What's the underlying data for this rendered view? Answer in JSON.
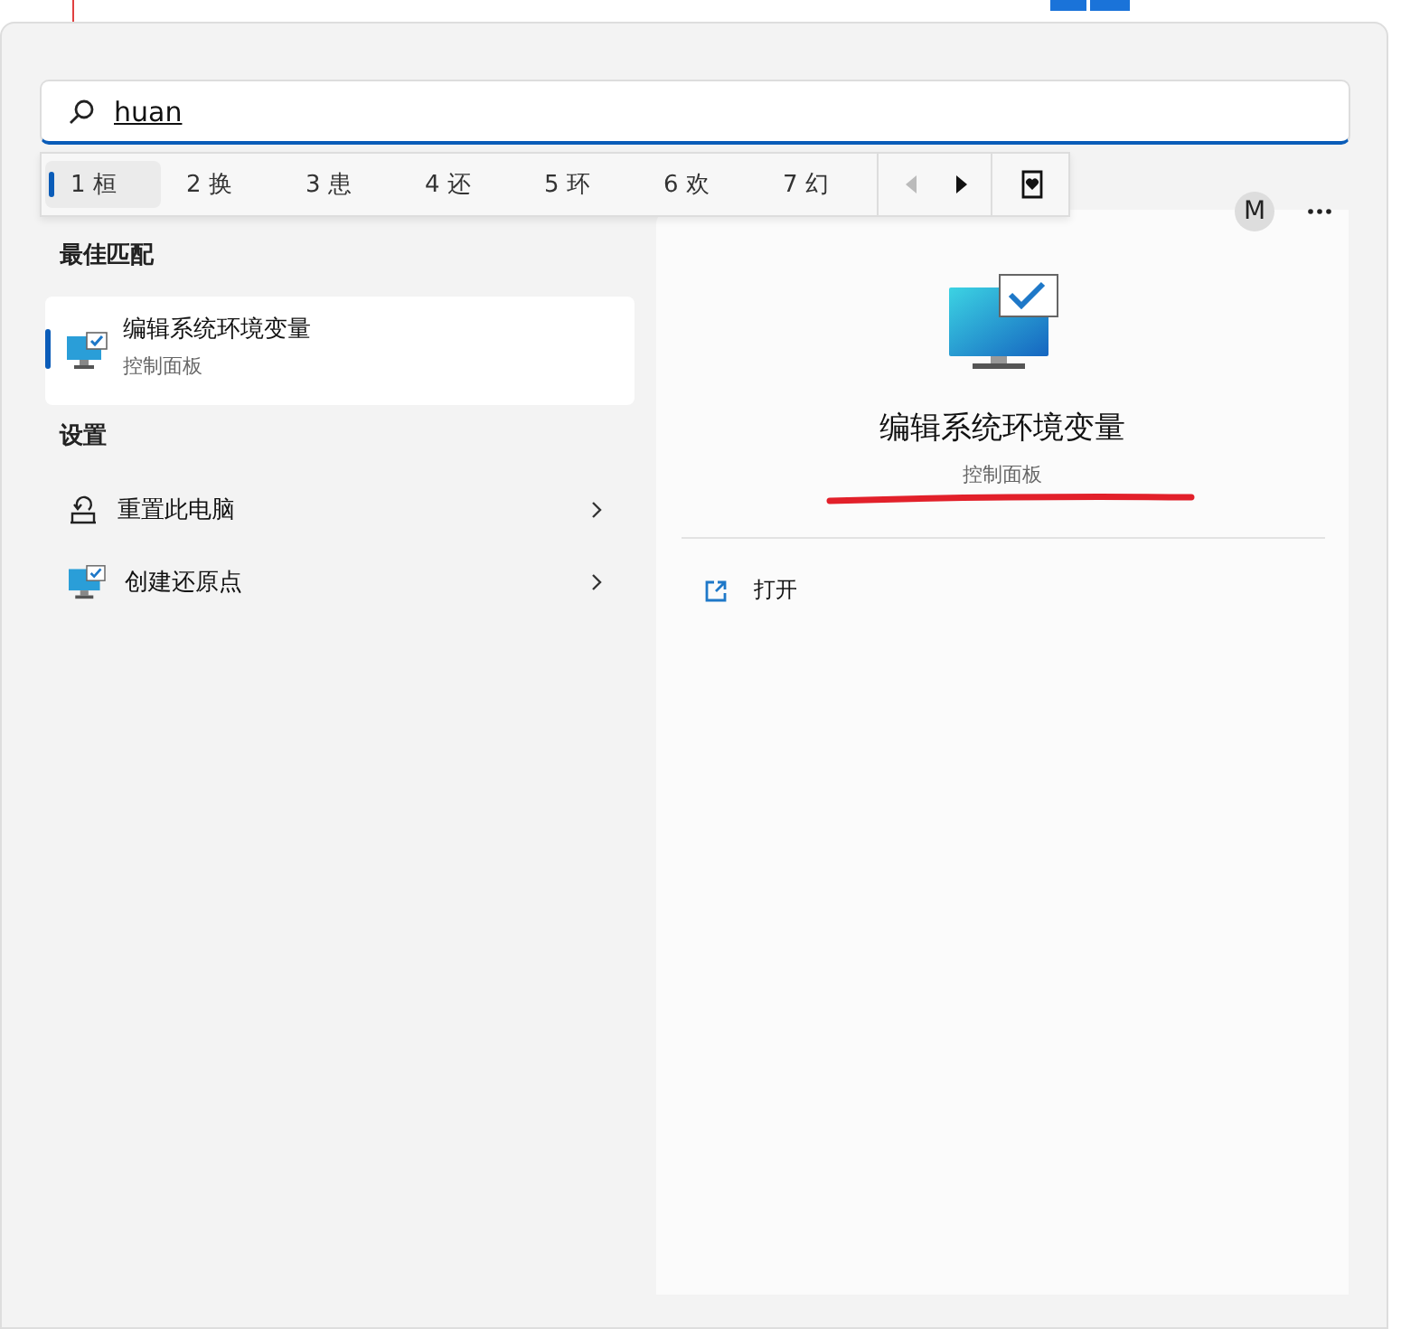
{
  "search": {
    "value": "huan"
  },
  "ime_candidates": [
    {
      "number": "1",
      "text": "桓",
      "selected": true
    },
    {
      "number": "2",
      "text": "换",
      "selected": false
    },
    {
      "number": "3",
      "text": "患",
      "selected": false
    },
    {
      "number": "4",
      "text": "还",
      "selected": false
    },
    {
      "number": "5",
      "text": "环",
      "selected": false
    },
    {
      "number": "6",
      "text": "欢",
      "selected": false
    },
    {
      "number": "7",
      "text": "幻",
      "selected": false
    }
  ],
  "account": {
    "initial": "M"
  },
  "best_match": {
    "heading": "最佳匹配",
    "item": {
      "title": "编辑系统环境变量",
      "subtitle": "控制面板",
      "selected": true
    }
  },
  "settings": {
    "heading": "设置",
    "items": [
      {
        "kind": "reset",
        "title": "重置此电脑"
      },
      {
        "kind": "monitor",
        "title": "创建还原点"
      }
    ]
  },
  "detail": {
    "title": "编辑系统环境变量",
    "subtitle": "控制面板",
    "actions": [
      {
        "label": "打开"
      }
    ]
  }
}
